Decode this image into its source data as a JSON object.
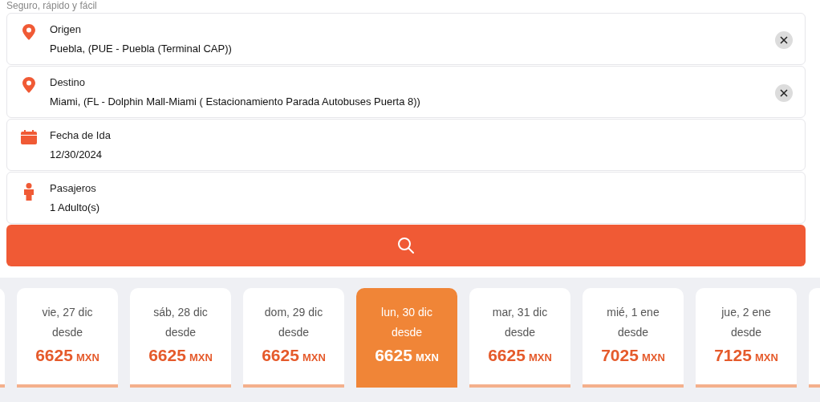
{
  "subtitle": "Seguro, rápido y fácil",
  "fields": [
    {
      "kind": "origin",
      "label": "Origen",
      "value": "Puebla, (PUE - Puebla (Terminal CAP))",
      "clearable": true
    },
    {
      "kind": "destination",
      "label": "Destino",
      "value": "Miami, (FL - Dolphin Mall-Miami ( Estacionamiento Parada Autobuses Puerta 8))",
      "clearable": true
    },
    {
      "kind": "date",
      "label": "Fecha de Ida",
      "value": "12/30/2024",
      "clearable": false
    },
    {
      "kind": "passengers",
      "label": "Pasajeros",
      "value": "1 Adulto(s)",
      "clearable": false
    }
  ],
  "dates": [
    {
      "date": "vie, 27 dic",
      "from": "desde",
      "price": "6625",
      "currency": "MXN",
      "selected": false
    },
    {
      "date": "sáb, 28 dic",
      "from": "desde",
      "price": "6625",
      "currency": "MXN",
      "selected": false
    },
    {
      "date": "dom, 29 dic",
      "from": "desde",
      "price": "6625",
      "currency": "MXN",
      "selected": false
    },
    {
      "date": "lun, 30 dic",
      "from": "desde",
      "price": "6625",
      "currency": "MXN",
      "selected": true
    },
    {
      "date": "mar, 31 dic",
      "from": "desde",
      "price": "6625",
      "currency": "MXN",
      "selected": false
    },
    {
      "date": "mié, 1 ene",
      "from": "desde",
      "price": "7025",
      "currency": "MXN",
      "selected": false
    },
    {
      "date": "jue, 2 ene",
      "from": "desde",
      "price": "7125",
      "currency": "MXN",
      "selected": false
    }
  ]
}
